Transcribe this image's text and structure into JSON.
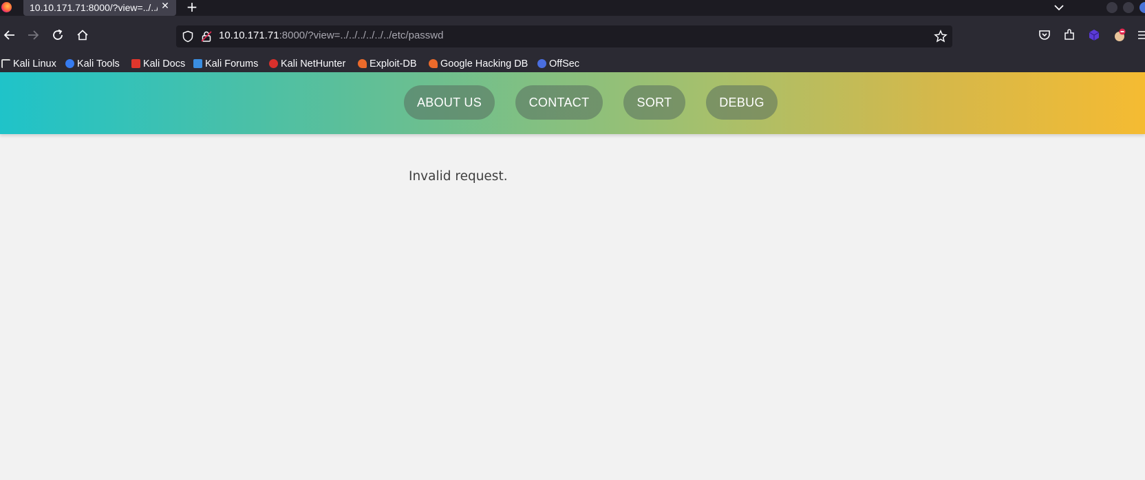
{
  "browser": {
    "tab": {
      "title": "10.10.171.71:8000/?view=../../",
      "close_icon": "close-icon"
    },
    "new_tab_icon": "plus-icon",
    "url": {
      "host": "10.10.171.71",
      "rest": ":8000/?view=../../../../../../etc/passwd"
    },
    "toolbar_icons": [
      "back-arrow-icon",
      "forward-arrow-icon",
      "reload-icon",
      "home-icon",
      "shield-icon",
      "lock-icon",
      "star-icon",
      "pocket-icon",
      "extensions-icon",
      "cube-icon",
      "avatar-icon",
      "menu-icon"
    ],
    "bookmarks": [
      {
        "label": "Kali Linux",
        "icon": "kali-dragon-icon",
        "color": "#d8d8d8"
      },
      {
        "label": "Kali Tools",
        "icon": "kali-tools-icon",
        "color": "#367bf0"
      },
      {
        "label": "Kali Docs",
        "icon": "kali-docs-icon",
        "color": "#e0362c"
      },
      {
        "label": "Kali Forums",
        "icon": "kali-forums-icon",
        "color": "#3a8de0"
      },
      {
        "label": "Kali NetHunter",
        "icon": "nethunter-icon",
        "color": "#d9302c"
      },
      {
        "label": "Exploit-DB",
        "icon": "exploit-db-icon",
        "color": "#ec6a2b"
      },
      {
        "label": "Google Hacking DB",
        "icon": "ghdb-icon",
        "color": "#ec6a2b"
      },
      {
        "label": "OffSec",
        "icon": "offsec-icon",
        "color": "#4a6ee0"
      }
    ]
  },
  "page": {
    "nav": [
      "ABOUT US",
      "CONTACT",
      "SORT",
      "DEBUG"
    ],
    "message": "Invalid request.",
    "gradient_colors": [
      "#1fc3c9",
      "#f5bb32"
    ]
  }
}
